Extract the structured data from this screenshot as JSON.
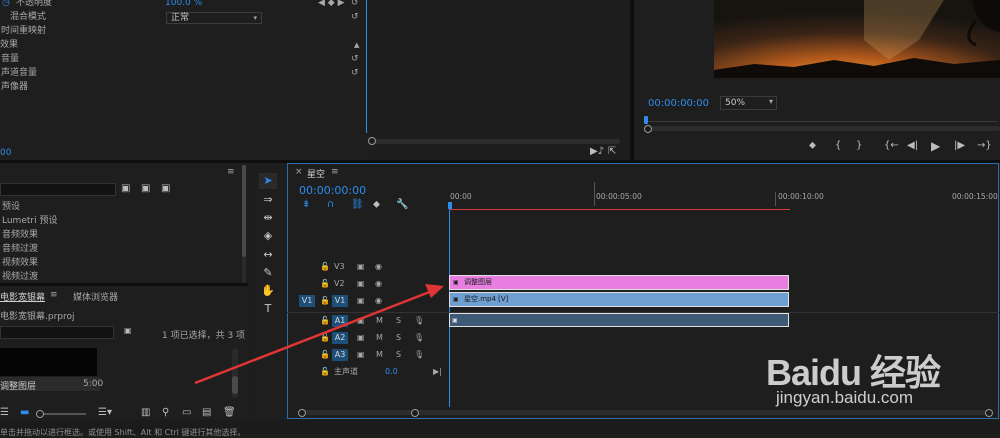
{
  "effect_controls": {
    "rows": [
      {
        "label": "不透明度",
        "value": "100.0 %",
        "indent": 1
      },
      {
        "label": "混合模式",
        "value": "正常",
        "indent": 2,
        "dropdown": true
      },
      {
        "label": "时间重映射",
        "value": "",
        "indent": 0
      },
      {
        "label": "效果",
        "value": "",
        "indent": 0
      },
      {
        "label": "音量",
        "value": "",
        "indent": 0
      },
      {
        "label": "声道音量",
        "value": "",
        "indent": 0
      },
      {
        "label": "声像器",
        "value": "",
        "indent": 0
      }
    ],
    "timecode": "00"
  },
  "program_monitor": {
    "timecode": "00:00:00:00",
    "zoom": "50%"
  },
  "effects_panel": {
    "items": [
      "预设",
      "Lumetri 预设",
      "音频效果",
      "音频过渡",
      "视频效果",
      "视频过渡"
    ]
  },
  "project_panel": {
    "tabs": [
      "电影宽银幕",
      "媒体浏览器"
    ],
    "file": "电影宽银幕.prproj",
    "status": "1 项已选择，共 3 项",
    "item_name": "调整图层",
    "item_duration": "5:00"
  },
  "timeline": {
    "tab": "星空",
    "timecode": "00:00:00:00",
    "ruler": [
      "00:00",
      "00:00:05:00",
      "00:00:10:00",
      "00:00:15:00"
    ],
    "tracks": [
      {
        "id": "V3",
        "kind": "video",
        "source": ""
      },
      {
        "id": "V2",
        "kind": "video",
        "source": ""
      },
      {
        "id": "V1",
        "kind": "video",
        "source": "V1"
      },
      {
        "id": "A1",
        "kind": "audio",
        "source": ""
      },
      {
        "id": "A2",
        "kind": "audio",
        "source": ""
      },
      {
        "id": "A3",
        "kind": "audio",
        "source": ""
      }
    ],
    "master_label": "主声道",
    "master_value": "0.0",
    "mute_label": "M",
    "solo_label": "S",
    "clips": {
      "adjustment": "调整图层",
      "video": "星空.mp4 [V]"
    }
  },
  "status_bar": "单击并拖动以进行框选。或使用 Shift、Alt 和 Ctrl 键进行其他选择。",
  "watermark": {
    "brand": "Baidu 经验",
    "url": "jingyan.baidu.com"
  },
  "colors": {
    "accent_blue": "#2d8ceb",
    "adjustment_clip": "#e77ee0",
    "video_clip": "#6f9ed1",
    "playhead_red": "#d63a3a",
    "annotation_arrow": "#e03535"
  }
}
